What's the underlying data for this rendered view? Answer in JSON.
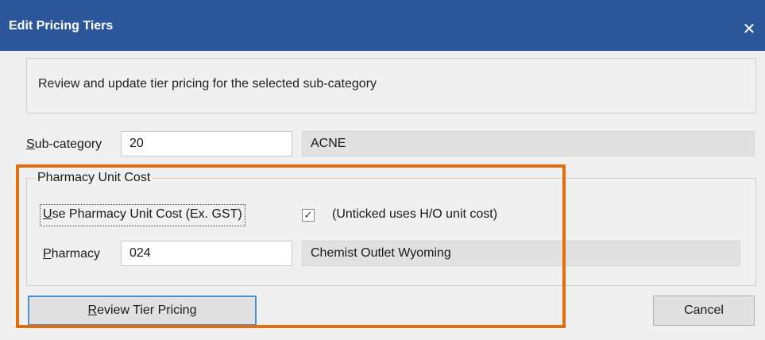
{
  "window": {
    "title": "Edit Pricing Tiers",
    "close_glyph": "✕",
    "close_icon": "close-icon"
  },
  "info": {
    "text": "Review and update tier pricing for the selected sub-category"
  },
  "subcategory": {
    "label_first": "S",
    "label_rest": "ub-category",
    "code": "20",
    "name": "ACNE"
  },
  "pharmacy_unit_cost": {
    "group_title": "Pharmacy Unit Cost",
    "checkbox_label_first": "U",
    "checkbox_label_rest": "se Pharmacy Unit Cost (Ex. GST)",
    "checkbox_checked": true,
    "checkbox_glyph": "✓",
    "checkbox_hint": "(Unticked uses H/O unit cost)",
    "pharmacy_label_first": "P",
    "pharmacy_label_rest": "harmacy",
    "pharmacy_code": "024",
    "pharmacy_name": "Chemist Outlet Wyoming"
  },
  "buttons": {
    "review_first": "R",
    "review_rest": "eview Tier Pricing",
    "cancel": "Cancel"
  },
  "colors": {
    "titlebar": "#2b579a",
    "highlight": "#e26d0b",
    "primary_button_border": "#4a90d9"
  }
}
